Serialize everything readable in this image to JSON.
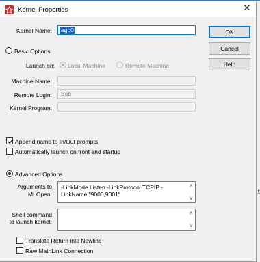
{
  "window": {
    "title": "Kernel Properties",
    "close_glyph": "✕"
  },
  "fields": {
    "kernel_name": {
      "label": "Kernel Name:",
      "value": "ago0"
    },
    "machine_name": {
      "label": "Machine Name:",
      "value": ""
    },
    "remote_login": {
      "label": "Remote Login:",
      "value": "Bob"
    },
    "kernel_program": {
      "label": "Kernel Program:",
      "value": ""
    }
  },
  "buttons": {
    "ok": "OK",
    "cancel": "Cancel",
    "help": "Help"
  },
  "basic_options": {
    "label": "Basic Options",
    "selected": false,
    "launch_on_label": "Launch on:",
    "local_machine": "Local Machine",
    "remote_machine": "Remote Machine"
  },
  "checkboxes": {
    "append_name": {
      "label": "Append name to In/Out prompts",
      "checked": true
    },
    "auto_launch": {
      "label": "Automatically launch on front end startup",
      "checked": false
    },
    "translate_return": {
      "label": "Translate Return into Newline",
      "checked": false
    },
    "raw_mathlink": {
      "label": "Raw MathLink Connection",
      "checked": false
    }
  },
  "advanced_options": {
    "label": "Advanced Options",
    "selected": true,
    "arguments_label_1": "Arguments to",
    "arguments_label_2": "MLOpen:",
    "arguments_value": "-LinkMode Listen -LinkProtocol TCPIP -LinkName \"9000,9001\"",
    "shell_label_1": "Shell command",
    "shell_label_2": "to launch kernel:",
    "shell_value": ""
  },
  "edge_char": "t"
}
